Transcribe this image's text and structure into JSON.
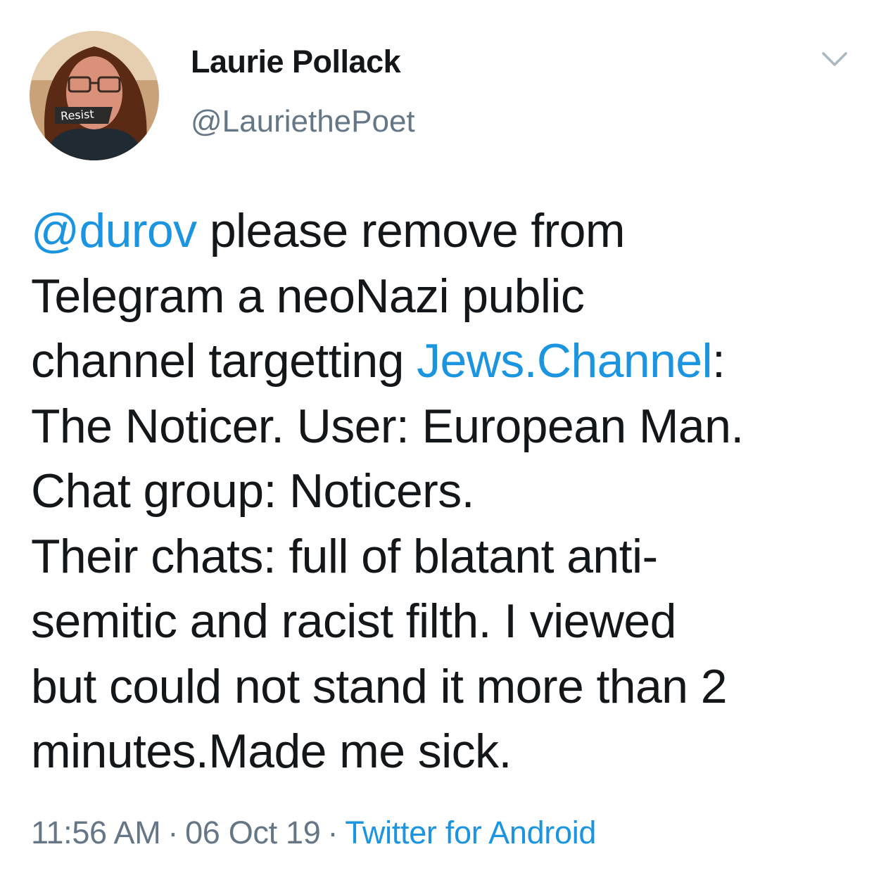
{
  "tweet": {
    "author": {
      "display_name": "Laurie Pollack",
      "handle": "@LauriethePoet",
      "avatar_badge_text": "Resist"
    },
    "menu_icon": "chevron-down-icon",
    "body": {
      "mention": "@durov",
      "line1_rest": " please remove from",
      "line2": "Telegram a neoNazi public",
      "line3_pre": "channel targetting ",
      "line3_link": "Jews.Channel",
      "line3_post": ":",
      "line4": "The Noticer. User: European Man.",
      "line5": "Chat group: Noticers.",
      "line6": "Their chats:  full of blatant anti-",
      "line7": "semitic and racist filth. I viewed",
      "line8": "but could not stand it more than 2",
      "line9": "minutes.Made me sick."
    },
    "meta": {
      "time": "11:56 AM",
      "separator": "·",
      "date": "06 Oct 19",
      "source": "Twitter for Android"
    }
  },
  "colors": {
    "text": "#14171a",
    "secondary": "#657786",
    "link": "#1b95e0"
  }
}
